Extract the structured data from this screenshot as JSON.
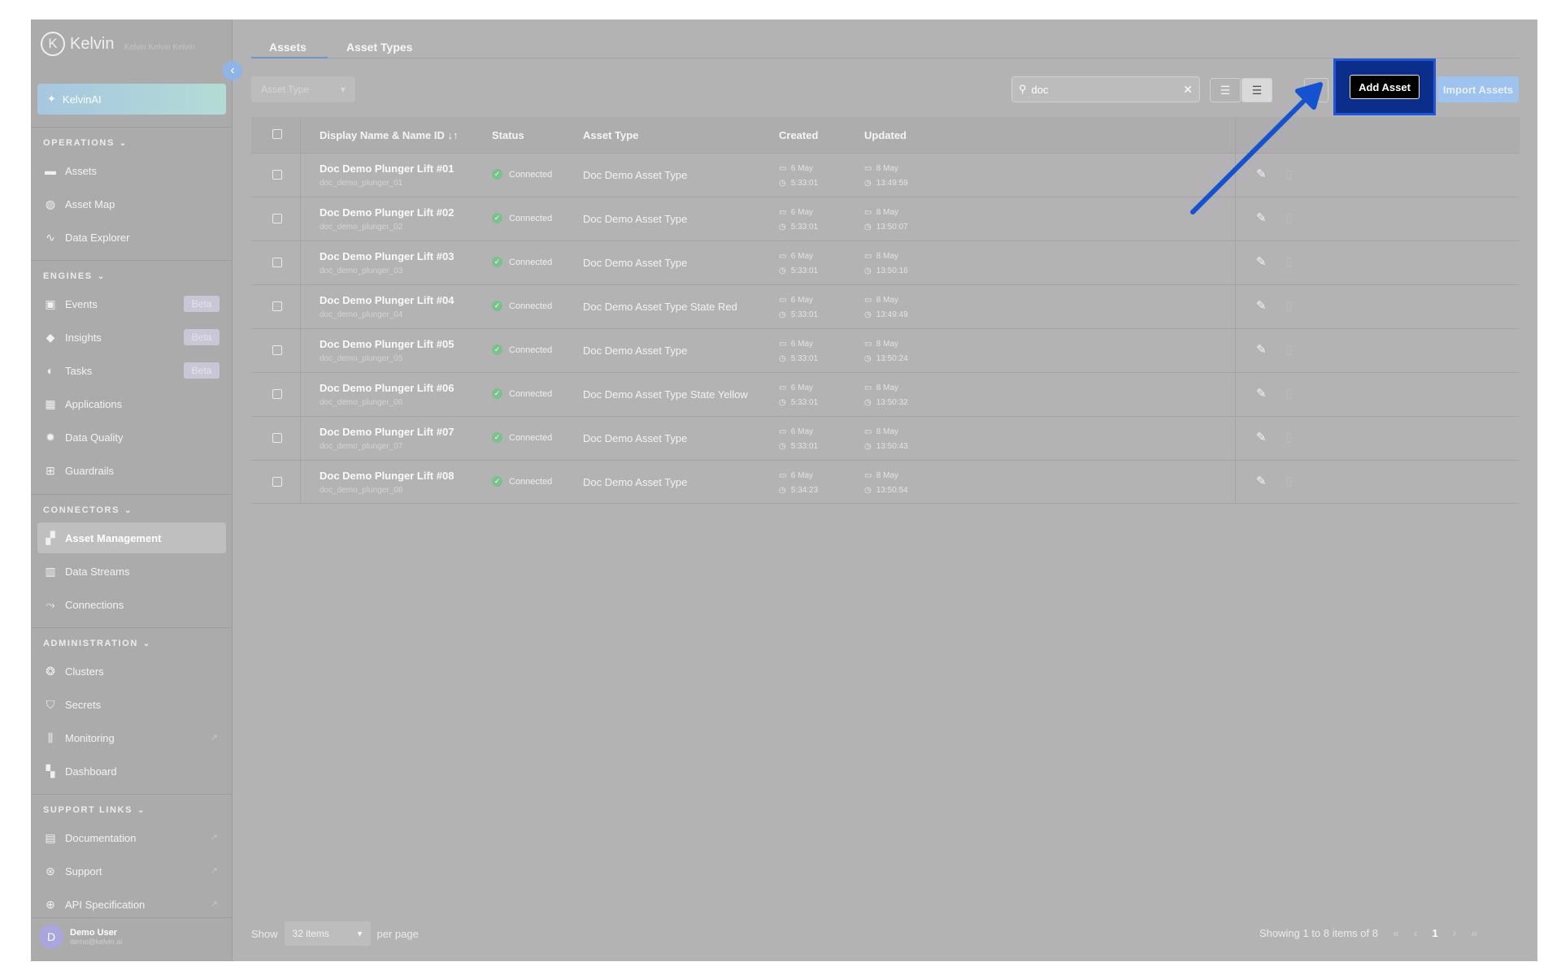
{
  "app": {
    "brand": "Kelvin",
    "brand_sub": "Kelvin Kelvin Kelvin"
  },
  "sidebar": {
    "ai_label": "KelvinAI",
    "sections": {
      "operations": "OPERATIONS",
      "engines": "ENGINES",
      "connectors": "CONNECTORS",
      "administration": "ADMINISTRATION",
      "support": "SUPPORT LINKS"
    },
    "items": {
      "assets": "Assets",
      "asset_map": "Asset Map",
      "data_explorer": "Data Explorer",
      "events": "Events",
      "insights": "Insights",
      "tasks": "Tasks",
      "applications": "Applications",
      "data_quality": "Data Quality",
      "guardrails": "Guardrails",
      "asset_management": "Asset Management",
      "data_streams": "Data Streams",
      "connections": "Connections",
      "clusters": "Clusters",
      "secrets": "Secrets",
      "monitoring": "Monitoring",
      "dashboard": "Dashboard",
      "documentation": "Documentation",
      "support": "Support",
      "api_spec": "API Specification"
    },
    "beta_label": "Beta",
    "user": {
      "initial": "D",
      "name": "Demo User",
      "email": "demo@kelvin.ai"
    }
  },
  "tabs": {
    "assets": "Assets",
    "asset_types": "Asset Types"
  },
  "toolbar": {
    "filter_placeholder": "Asset Type",
    "search_value": "doc",
    "add_label": "Add Asset",
    "import_label": "Import Assets"
  },
  "table": {
    "headers": {
      "name": "Display Name & Name ID",
      "status": "Status",
      "type": "Asset Type",
      "created": "Created",
      "updated": "Updated"
    },
    "rows": [
      {
        "name": "Doc Demo Plunger Lift #01",
        "id": "doc_demo_plunger_01",
        "status": "Connected",
        "type": "Doc Demo Asset Type",
        "c_date": "6 May",
        "c_time": "5:33:01",
        "u_date": "8 May",
        "u_time": "13:49:59"
      },
      {
        "name": "Doc Demo Plunger Lift #02",
        "id": "doc_demo_plunger_02",
        "status": "Connected",
        "type": "Doc Demo Asset Type",
        "c_date": "6 May",
        "c_time": "5:33:01",
        "u_date": "8 May",
        "u_time": "13:50:07"
      },
      {
        "name": "Doc Demo Plunger Lift #03",
        "id": "doc_demo_plunger_03",
        "status": "Connected",
        "type": "Doc Demo Asset Type",
        "c_date": "6 May",
        "c_time": "5:33:01",
        "u_date": "8 May",
        "u_time": "13:50:16"
      },
      {
        "name": "Doc Demo Plunger Lift #04",
        "id": "doc_demo_plunger_04",
        "status": "Connected",
        "type": "Doc Demo Asset Type State Red",
        "c_date": "6 May",
        "c_time": "5:33:01",
        "u_date": "8 May",
        "u_time": "13:49:49"
      },
      {
        "name": "Doc Demo Plunger Lift #05",
        "id": "doc_demo_plunger_05",
        "status": "Connected",
        "type": "Doc Demo Asset Type",
        "c_date": "6 May",
        "c_time": "5:33:01",
        "u_date": "8 May",
        "u_time": "13:50:24"
      },
      {
        "name": "Doc Demo Plunger Lift #06",
        "id": "doc_demo_plunger_06",
        "status": "Connected",
        "type": "Doc Demo Asset Type State Yellow",
        "c_date": "6 May",
        "c_time": "5:33:01",
        "u_date": "8 May",
        "u_time": "13:50:32"
      },
      {
        "name": "Doc Demo Plunger Lift #07",
        "id": "doc_demo_plunger_07",
        "status": "Connected",
        "type": "Doc Demo Asset Type",
        "c_date": "6 May",
        "c_time": "5:33:01",
        "u_date": "8 May",
        "u_time": "13:50:43"
      },
      {
        "name": "Doc Demo Plunger Lift #08",
        "id": "doc_demo_plunger_08",
        "status": "Connected",
        "type": "Doc Demo Asset Type",
        "c_date": "6 May",
        "c_time": "5:34:23",
        "u_date": "8 May",
        "u_time": "13:50:54"
      }
    ]
  },
  "footer": {
    "show_label": "Show",
    "per_page_value": "32 items",
    "per_page_label": "per page",
    "showing": "Showing 1 to 8 items of 8",
    "current_page": "1"
  },
  "colors": {
    "highlight_box": "#0b2e8a",
    "annotation_arrow": "#1552d1",
    "import_button": "#9ec3ef",
    "status_ok": "#7bc18c"
  }
}
